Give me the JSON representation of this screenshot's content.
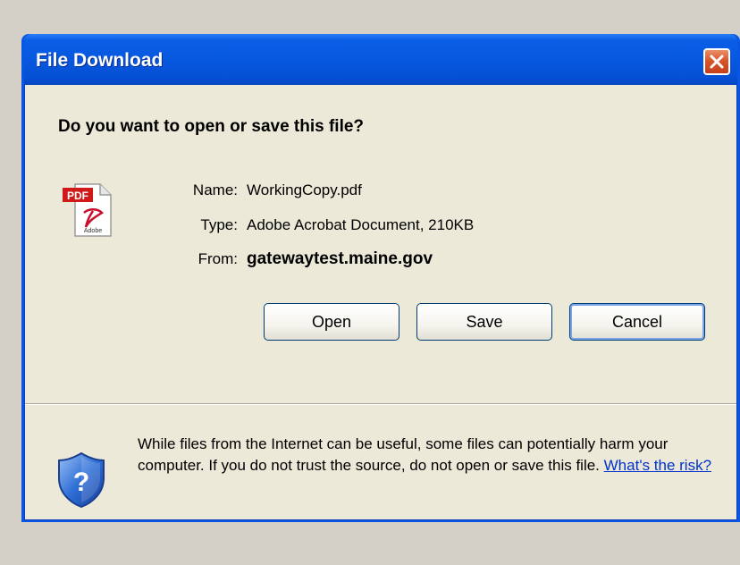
{
  "window": {
    "title": "File Download",
    "close_icon": "close-icon"
  },
  "dialog": {
    "question": "Do you want to open or save this file?",
    "file_icon": "pdf-file-icon",
    "name_label": "Name:",
    "name_value": "WorkingCopy.pdf",
    "type_label": "Type:",
    "type_value": "Adobe Acrobat Document, 210KB",
    "from_label": "From:",
    "from_value": "gatewaytest.maine.gov"
  },
  "buttons": {
    "open": "Open",
    "save": "Save",
    "cancel": "Cancel"
  },
  "warning": {
    "icon": "shield-question-icon",
    "text": "While files from the Internet can be useful, some files can potentially harm your computer. If you do not trust the source, do not open or save this file.",
    "link": "What's the risk?"
  },
  "colors": {
    "titlebar": "#0758df",
    "client_bg": "#ece9d8",
    "desktop_bg": "#d4d0c8",
    "close_button": "#d9562b",
    "link": "#0033cc"
  }
}
